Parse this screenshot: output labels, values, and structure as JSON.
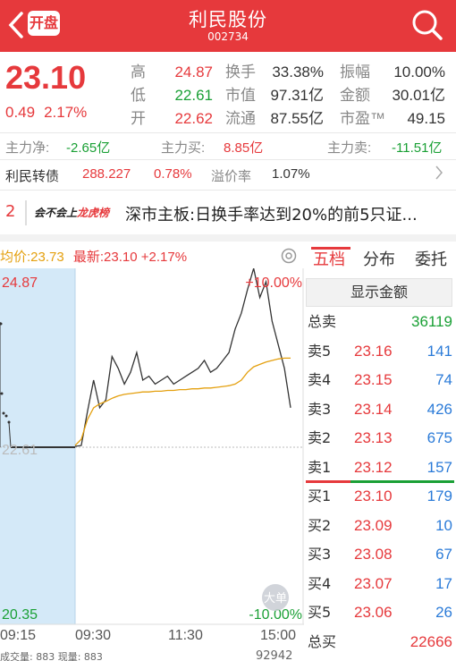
{
  "header": {
    "open_badge": "开盘",
    "stock_name": "利民股份",
    "stock_code": "002734"
  },
  "quote": {
    "price": "23.10",
    "change": "0.49",
    "change_pct": "2.17%",
    "high_label": "高",
    "high": "24.87",
    "low_label": "低",
    "low": "22.61",
    "open_label": "开",
    "open": "22.62",
    "turnover_label": "换手",
    "turnover": "33.38%",
    "mktcap_label": "市值",
    "mktcap": "97.31亿",
    "float_label": "流通",
    "float": "87.55亿",
    "amplitude_label": "振幅",
    "amplitude": "10.00%",
    "amount_label": "金额",
    "amount": "30.01亿",
    "pe_label": "市盈™",
    "pe": "49.15"
  },
  "money_flow": {
    "net_label": "主力净:",
    "net": "-2.65亿",
    "buy_label": "主力买:",
    "buy": "8.85亿",
    "sell_label": "主力卖:",
    "sell": "-11.51亿"
  },
  "convertible": {
    "label": "利民转债",
    "price": "288.227",
    "pct": "0.78%",
    "premium_label": "溢价率",
    "premium": "1.07%"
  },
  "news": {
    "index": "2",
    "brand_a": "会不会上",
    "brand_b": "龙虎榜",
    "text": "深市主板:日换手率达到20%的前5只证..."
  },
  "chart_header": {
    "avg": "均价:23.73",
    "last": "最新:23.10 +2.17%"
  },
  "chart_data": {
    "type": "line",
    "y_top_label": "24.87",
    "y_bottom_label": "20.35",
    "y_mid_label": "22.61",
    "pct_top_label": "+10.00%",
    "pct_bottom_label": "-10.00%",
    "x_ticks": [
      "09:15",
      "09:30",
      "11:30",
      "15:00"
    ],
    "ylim": [
      20.35,
      24.87
    ],
    "pre_close": 22.61,
    "badge": "大单",
    "series": [
      {
        "name": "price",
        "values": [
          22.61,
          22.62,
          23.05,
          23.45,
          23.1,
          23.2,
          23.75,
          23.6,
          23.4,
          23.55,
          23.8,
          23.45,
          23.5,
          23.4,
          23.45,
          23.5,
          23.4,
          23.45,
          23.5,
          23.55,
          23.6,
          23.7,
          23.55,
          23.6,
          23.7,
          23.8,
          24.1,
          24.3,
          24.6,
          24.87,
          24.5,
          24.7,
          24.2,
          23.9,
          23.6,
          23.1
        ]
      },
      {
        "name": "avg",
        "values": [
          22.62,
          22.7,
          22.95,
          23.1,
          23.15,
          23.18,
          23.22,
          23.25,
          23.27,
          23.28,
          23.29,
          23.3,
          23.3,
          23.31,
          23.31,
          23.32,
          23.32,
          23.33,
          23.33,
          23.34,
          23.34,
          23.35,
          23.35,
          23.36,
          23.37,
          23.38,
          23.4,
          23.45,
          23.55,
          23.62,
          23.65,
          23.68,
          23.7,
          23.72,
          23.73,
          23.73
        ]
      }
    ]
  },
  "volume": {
    "label": "成交量: 883 现量: 883",
    "right": "92942"
  },
  "tabs": [
    "五档",
    "分布",
    "委托"
  ],
  "show_amount": "显示金额",
  "order_book": {
    "total_sell_label": "总卖",
    "total_sell": "36119",
    "asks": [
      {
        "label": "卖5",
        "price": "23.16",
        "vol": "141"
      },
      {
        "label": "卖4",
        "price": "23.15",
        "vol": "74"
      },
      {
        "label": "卖3",
        "price": "23.14",
        "vol": "426"
      },
      {
        "label": "卖2",
        "price": "23.13",
        "vol": "675"
      },
      {
        "label": "卖1",
        "price": "23.12",
        "vol": "157"
      }
    ],
    "bids": [
      {
        "label": "买1",
        "price": "23.10",
        "vol": "179"
      },
      {
        "label": "买2",
        "price": "23.09",
        "vol": "10"
      },
      {
        "label": "买3",
        "price": "23.08",
        "vol": "67"
      },
      {
        "label": "买4",
        "price": "23.07",
        "vol": "17"
      },
      {
        "label": "买5",
        "price": "23.06",
        "vol": "26"
      }
    ],
    "total_buy_label": "总买",
    "total_buy": "22666"
  },
  "colors": {
    "up": "#e6393c",
    "down": "#1aa035",
    "avg": "#e4a00f"
  }
}
